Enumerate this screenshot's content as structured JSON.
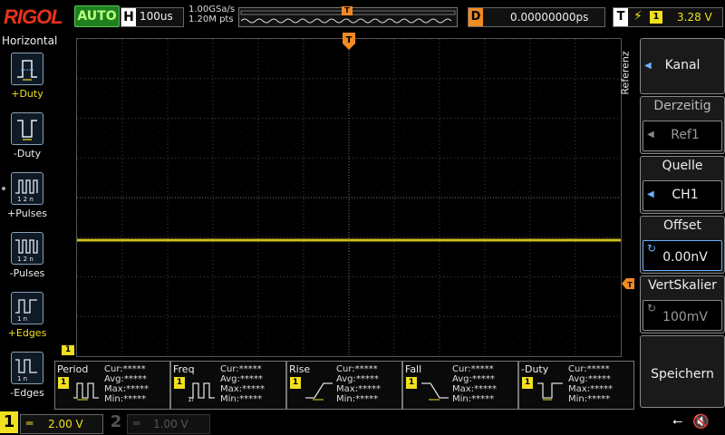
{
  "header": {
    "brand": "RIGOL",
    "mode": "AUTO",
    "horizontal_key": "H",
    "timebase": "100us",
    "sample_rate": "1.00GSa/s",
    "mem_depth": "1.20M pts",
    "delay_key": "D",
    "delay": "0.00000000ps",
    "trigger_key": "T",
    "trigger_source": "1",
    "trigger_level": "3.28 V",
    "trigger_marker": "T"
  },
  "left_panel": {
    "title": "Horizontal",
    "items": [
      {
        "label": "+Duty",
        "icon": "plus-duty-icon"
      },
      {
        "label": "-Duty",
        "icon": "minus-duty-icon"
      },
      {
        "label": "+Pulses",
        "icon": "plus-pulses-icon"
      },
      {
        "label": "-Pulses",
        "icon": "minus-pulses-icon"
      },
      {
        "label": "+Edges",
        "icon": "plus-edges-icon"
      },
      {
        "label": "-Edges",
        "icon": "minus-edges-icon"
      }
    ]
  },
  "measurements": [
    {
      "name": "Period",
      "cur": "Cur:*****",
      "avg": "Avg:*****",
      "max": "Max:*****",
      "min": "Min:*****"
    },
    {
      "name": "Freq",
      "cur": "Cur:*****",
      "avg": "Avg:*****",
      "max": "Max:*****",
      "min": "Min:*****"
    },
    {
      "name": "Rise",
      "cur": "Cur:*****",
      "avg": "Avg:*****",
      "max": "Max:*****",
      "min": "Min:*****"
    },
    {
      "name": "Fall",
      "cur": "Cur:*****",
      "avg": "Avg:*****",
      "max": "Max:*****",
      "min": "Min:*****"
    },
    {
      "name": "-Duty",
      "cur": "Cur:*****",
      "avg": "Avg:*****",
      "max": "Max:*****",
      "min": "Min:*****"
    }
  ],
  "meas_channel": "1",
  "right_panel": {
    "tab": "Referenz",
    "kanal": "Kanal",
    "derzeitig_label": "Derzeitig",
    "derzeitig_value": "Ref1",
    "quelle_label": "Quelle",
    "quelle_value": "CH1",
    "offset_label": "Offset",
    "offset_value": "0.00nV",
    "vertskalier_label": "VertSkalier",
    "vertskalier_value": "100mV",
    "speichern": "Speichern"
  },
  "bottom": {
    "ch1_num": "1",
    "ch1_scale": "2.00 V",
    "ch2_num": "2",
    "ch2_scale": "1.00 V"
  },
  "colors": {
    "ch1": "#f0e020",
    "trigger": "#f08a22",
    "brand": "#e8321c",
    "auto": "#1f7f1f"
  }
}
